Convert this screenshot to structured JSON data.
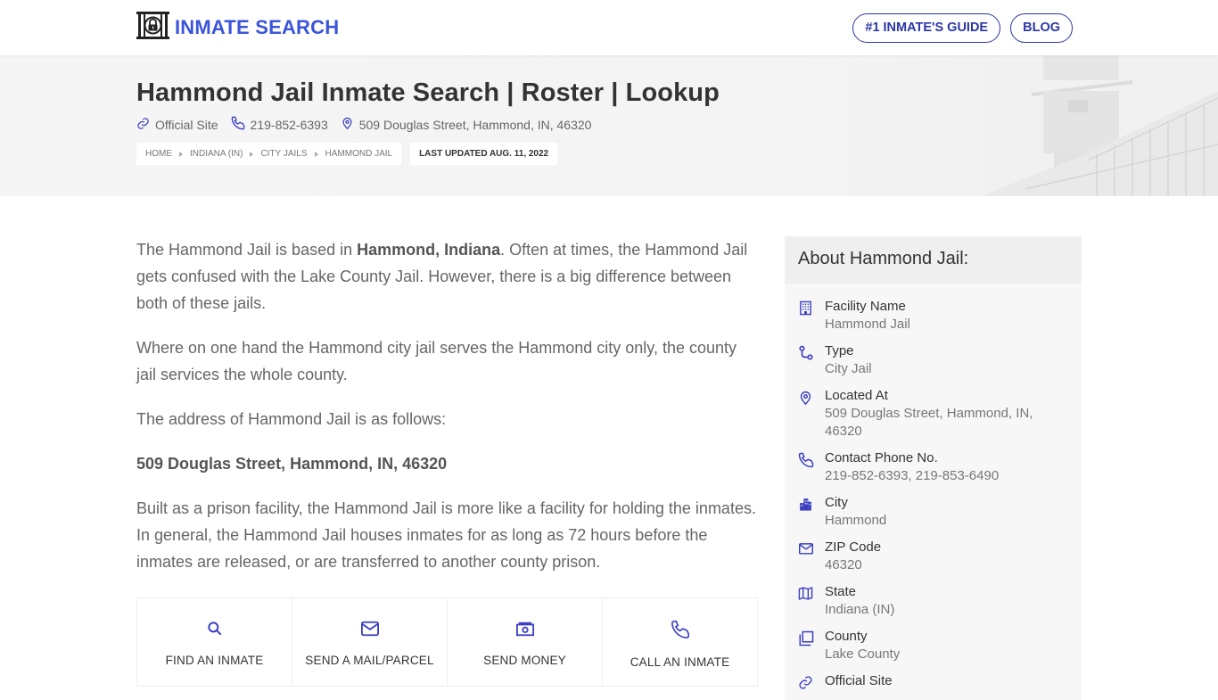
{
  "header": {
    "logo_text": "INMATE SEARCH",
    "logo_icon": "jail-lock-icon",
    "nav": [
      {
        "label": "#1 INMATE'S GUIDE"
      },
      {
        "label": "BLOG"
      }
    ]
  },
  "hero": {
    "title": "Hammond Jail Inmate Search | Roster | Lookup",
    "official_site": "Official Site",
    "phone": "219-852-6393",
    "address": "509 Douglas Street, Hammond, IN, 46320",
    "breadcrumb": [
      "HOME",
      "INDIANA (IN)",
      "CITY JAILS",
      "HAMMOND JAIL"
    ],
    "last_updated": "LAST UPDATED AUG. 11, 2022"
  },
  "article": {
    "p1_a": "The Hammond Jail is based in ",
    "p1_bold": "Hammond, Indiana",
    "p1_b": ". Often at times, the Hammond Jail gets confused with the Lake County Jail. However, there is a big difference between both of these jails.",
    "p2": "Where on one hand the Hammond city jail serves the Hammond city only, the county jail services the whole county.",
    "p3": "The address of Hammond Jail is as follows:",
    "p4_bold": "509 Douglas Street, Hammond, IN, 46320",
    "p5": "Built as a prison facility, the Hammond Jail is more like a facility for holding the inmates. In general, the Hammond Jail houses inmates for as long as 72 hours before the inmates are released, or are transferred to another county prison."
  },
  "actions": [
    {
      "label": "FIND AN INMATE",
      "icon": "search-icon"
    },
    {
      "label": "SEND A MAIL/PARCEL",
      "icon": "mail-icon"
    },
    {
      "label": "SEND MONEY",
      "icon": "money-icon"
    },
    {
      "label": "CALL AN INMATE",
      "icon": "phone-icon"
    }
  ],
  "sidebar": {
    "title": "About Hammond Jail:",
    "items": [
      {
        "label": "Facility Name",
        "value": "Hammond Jail",
        "icon": "building-icon"
      },
      {
        "label": "Type",
        "value": "City Jail",
        "icon": "route-icon"
      },
      {
        "label": "Located At",
        "value": "509 Douglas Street, Hammond, IN, 46320",
        "icon": "map-pin-icon"
      },
      {
        "label": "Contact Phone No.",
        "value": "219-852-6393, 219-853-6490",
        "icon": "phone-icon"
      },
      {
        "label": "City",
        "value": "Hammond",
        "icon": "city-icon"
      },
      {
        "label": "ZIP Code",
        "value": "46320",
        "icon": "envelope-icon"
      },
      {
        "label": "State",
        "value": "Indiana (IN)",
        "icon": "map-icon"
      },
      {
        "label": "County",
        "value": "Lake County",
        "icon": "copy-icon"
      },
      {
        "label": "Official Site",
        "value": "",
        "icon": "link-icon"
      }
    ]
  },
  "colors": {
    "brand": "#3b55d9",
    "nav_outline": "#2b37a6",
    "icon": "#3b3fc0"
  }
}
